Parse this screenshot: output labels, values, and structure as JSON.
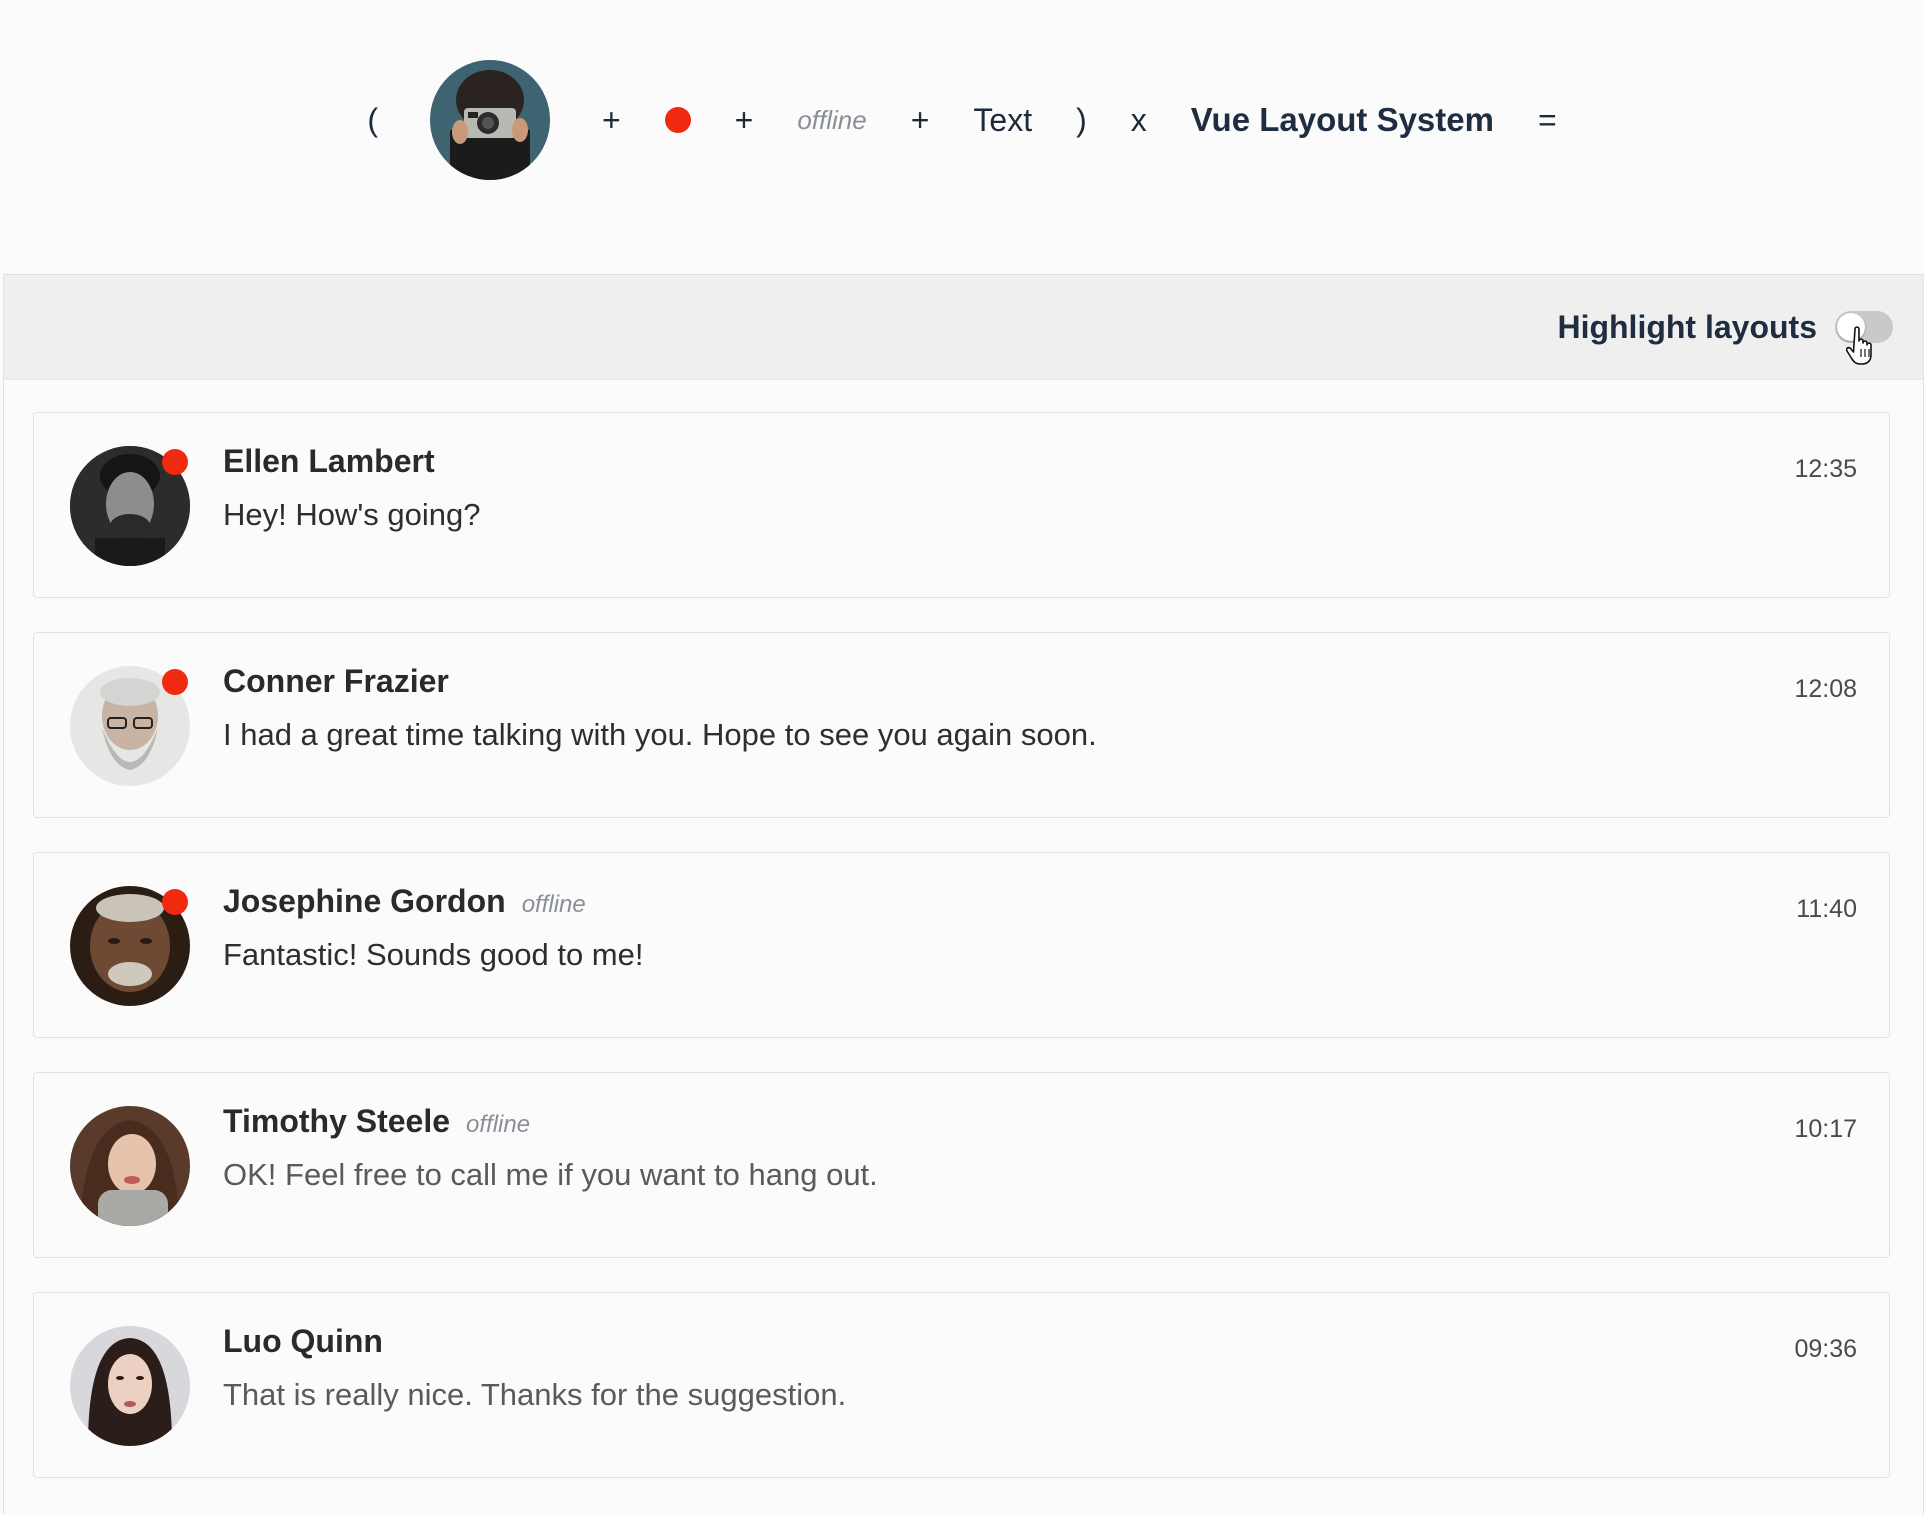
{
  "formula": {
    "open_paren": "(",
    "plus1": "+",
    "plus2": "+",
    "offline": "offline",
    "plus3": "+",
    "text": "Text",
    "close_paren": ")",
    "times": "x",
    "brand": "Vue Layout System",
    "equals": "="
  },
  "toolbar": {
    "highlight_label": "Highlight layouts",
    "highlight_enabled": false
  },
  "colors": {
    "status_dot": "#ef2a10",
    "toggle_off": "#c9c9c9",
    "brand_text": "#1f2d40"
  },
  "messages": [
    {
      "name": "Ellen Lambert",
      "offline_label": "",
      "text": "Hey! How's going?",
      "time": "12:35",
      "online": true
    },
    {
      "name": "Conner Frazier",
      "offline_label": "",
      "text": "I had a great time talking with you. Hope to see you again soon.",
      "time": "12:08",
      "online": true
    },
    {
      "name": "Josephine Gordon",
      "offline_label": "offline",
      "text": "Fantastic! Sounds good to me!",
      "time": "11:40",
      "online": true
    },
    {
      "name": "Timothy Steele",
      "offline_label": "offline",
      "text": "OK! Feel free to call me if you want to hang out.",
      "time": "10:17",
      "online": false
    },
    {
      "name": "Luo Quinn",
      "offline_label": "",
      "text": "That is really nice. Thanks for the suggestion.",
      "time": "09:36",
      "online": false
    }
  ]
}
